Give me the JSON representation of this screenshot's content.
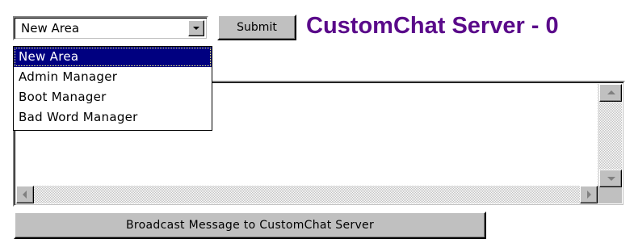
{
  "area_select": {
    "value": "New Area",
    "options": [
      "New Area",
      "Admin Manager",
      "Boot Manager",
      "Bad Word Manager"
    ]
  },
  "submit_label": "Submit",
  "title": "CustomChat Server - 0",
  "broadcast_label": "Broadcast Message to CustomChat Server",
  "colors": {
    "title": "#5a0a8a",
    "selection": "#000080",
    "face": "#c0c0c0"
  }
}
